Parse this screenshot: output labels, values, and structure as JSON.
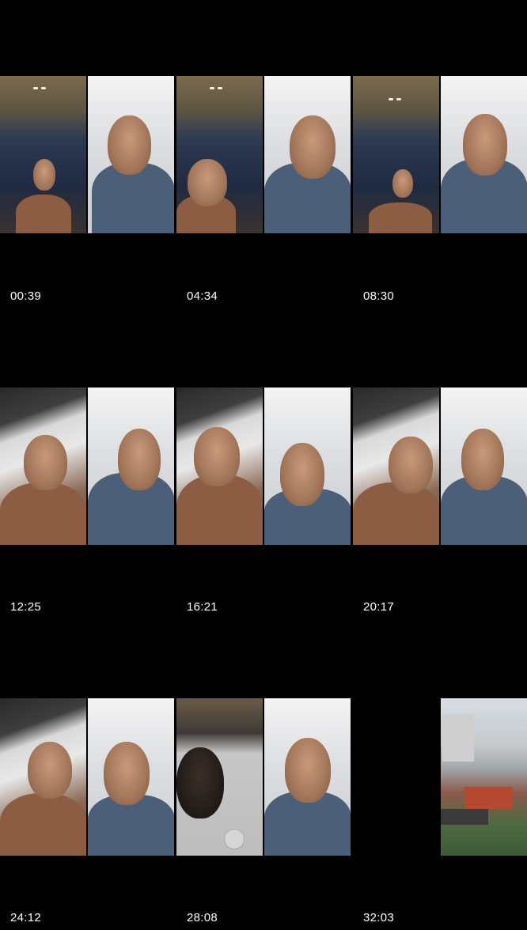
{
  "tiles": [
    {
      "timestamp": "00:39",
      "left_scene": "bathroom",
      "right_scene": "white-wall"
    },
    {
      "timestamp": "04:34",
      "left_scene": "bathroom",
      "right_scene": "white-wall"
    },
    {
      "timestamp": "08:30",
      "left_scene": "bathroom",
      "right_scene": "white-wall"
    },
    {
      "timestamp": "12:25",
      "left_scene": "bed",
      "right_scene": "white-wall"
    },
    {
      "timestamp": "16:21",
      "left_scene": "bed",
      "right_scene": "white-wall"
    },
    {
      "timestamp": "20:17",
      "left_scene": "bed",
      "right_scene": "white-wall"
    },
    {
      "timestamp": "24:12",
      "left_scene": "bed",
      "right_scene": "white-wall"
    },
    {
      "timestamp": "28:08",
      "left_scene": "dark-room",
      "right_scene": "white-wall"
    },
    {
      "timestamp": "32:03",
      "left_scene": "empty",
      "right_scene": "outdoor-rooftops"
    }
  ]
}
